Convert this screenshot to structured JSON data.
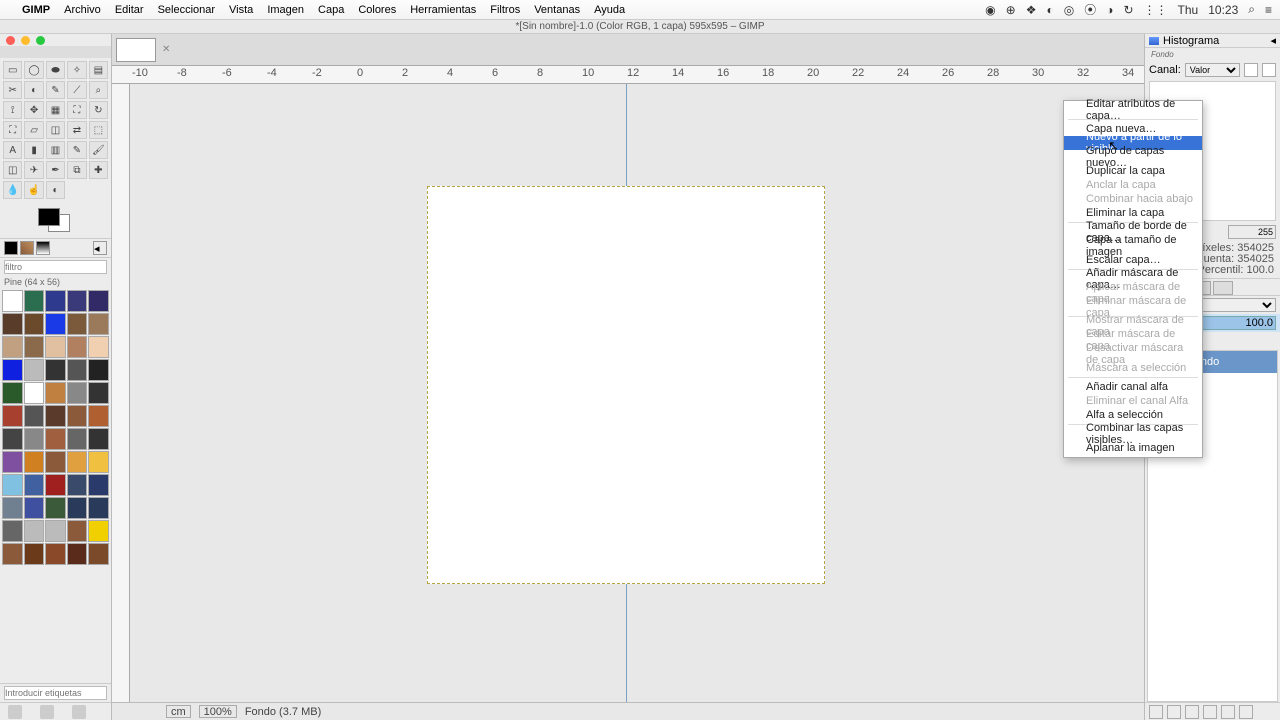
{
  "menubar": {
    "app": "GIMP",
    "items": [
      "Archivo",
      "Editar",
      "Seleccionar",
      "Vista",
      "Imagen",
      "Capa",
      "Colores",
      "Herramientas",
      "Filtros",
      "Ventanas",
      "Ayuda"
    ],
    "clock_day": "Thu",
    "clock_time": "10:23"
  },
  "window_title": "*[Sin nombre]-1.0 (Color RGB, 1 capa) 595x595 – GIMP",
  "toolbox": {
    "filter_placeholder": "filtro",
    "pine_label": "Pine (64 x 56)",
    "tag_placeholder": "Introducir etiquetas"
  },
  "ruler_marks": [
    "-10",
    "-8",
    "-6",
    "-4",
    "-2",
    "0",
    "2",
    "4",
    "6",
    "8",
    "10",
    "12",
    "14",
    "16",
    "18",
    "20",
    "22",
    "24",
    "26",
    "28",
    "30",
    "32",
    "34"
  ],
  "status": {
    "unit": "cm",
    "zoom": "100%",
    "layer_info": "Fondo (3.7 MB)"
  },
  "rightdock": {
    "hist_tab": "Histograma",
    "fondo": "Fondo",
    "canal_label": "Canal:",
    "canal_value": "Valor",
    "val255": "255",
    "pixeles": "Píxeles:",
    "pixeles_v": "354025",
    "cuenta": "Cuenta:",
    "cuenta_v": "354025",
    "percentil": "Percentil:",
    "percentil_v": "100.0",
    "opacity": "100.0",
    "layer_name": "Fondo"
  },
  "context_menu": {
    "items": [
      {
        "label": "Editar atributos de capa…",
        "state": "normal"
      },
      {
        "sep": true
      },
      {
        "label": "Capa nueva…",
        "state": "normal"
      },
      {
        "label": "Nuevo a partir de lo visible",
        "state": "hl"
      },
      {
        "label": "Grupo de capas nuevo…",
        "state": "normal"
      },
      {
        "label": "Duplicar la capa",
        "state": "normal"
      },
      {
        "label": "Anclar la capa",
        "state": "disabled"
      },
      {
        "label": "Combinar hacia abajo",
        "state": "disabled"
      },
      {
        "label": "Eliminar la capa",
        "state": "normal"
      },
      {
        "sep": true
      },
      {
        "label": "Tamaño de borde de capa…",
        "state": "normal"
      },
      {
        "label": "Capa a tamaño de imagen",
        "state": "normal"
      },
      {
        "label": "Escalar capa…",
        "state": "normal"
      },
      {
        "sep": true
      },
      {
        "label": "Añadir máscara de capa…",
        "state": "normal"
      },
      {
        "label": "Aplicar máscara de capa",
        "state": "disabled"
      },
      {
        "label": "Eliminar máscara de capa",
        "state": "disabled"
      },
      {
        "sep": true
      },
      {
        "label": "Mostrar máscara de capa",
        "state": "disabled"
      },
      {
        "label": "Editar máscara de capa",
        "state": "disabled"
      },
      {
        "label": "Desactivar máscara de capa",
        "state": "disabled"
      },
      {
        "label": "Máscara a selección",
        "state": "disabled"
      },
      {
        "sep": true
      },
      {
        "label": "Añadir canal alfa",
        "state": "normal"
      },
      {
        "label": "Eliminar el canal Alfa",
        "state": "disabled"
      },
      {
        "label": "Alfa a selección",
        "state": "normal"
      },
      {
        "sep": true
      },
      {
        "label": "Combinar las capas visibles…",
        "state": "normal"
      },
      {
        "label": "Aplanar la imagen",
        "state": "normal"
      }
    ]
  },
  "pattern_colors": [
    "#fff",
    "#2a6e4f",
    "#2e3a8e",
    "#3a3a7a",
    "#322a66",
    "#5a3c2a",
    "#6a4a2a",
    "#1a3ae8",
    "#7a5a3a",
    "#9a7a5a",
    "#c0a080",
    "#8a6a4a",
    "#e0c0a0",
    "#b08060",
    "#f0d0b0",
    "#1020e0",
    "#bbb",
    "#333",
    "#555",
    "#222",
    "#2a5a2a",
    "#fff",
    "#c08040",
    "#888",
    "#333",
    "#a84030",
    "#555",
    "#5a3a2a",
    "#8a5a3a",
    "#b06030",
    "#444",
    "#888",
    "#a06040",
    "#666",
    "#333",
    "#8050a0",
    "#d08020",
    "#8a5a3a",
    "#e0a040",
    "#f0c040",
    "#80c0e0",
    "#4060a0",
    "#a02020",
    "#3a4a6a",
    "#2a3a6a",
    "#708090",
    "#4050a0",
    "#3a5a3a",
    "#2a3a5a",
    "#2a3a5a",
    "#666",
    "#bbb",
    "#bbb",
    "#8a5a3a",
    "#f0d000",
    "#8a5a3a",
    "#6a3a1a",
    "#8a4a2a",
    "#5a2a1a",
    "#7a4a2a"
  ]
}
